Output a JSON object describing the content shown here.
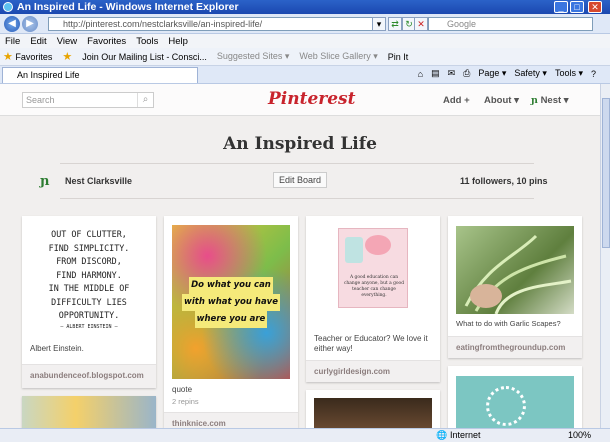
{
  "window": {
    "title": "An Inspired Life - Windows Internet Explorer"
  },
  "address": {
    "url": "http://pinterest.com/nestclarksville/an-inspired-life/",
    "search_placeholder": "Google"
  },
  "menu": [
    "File",
    "Edit",
    "View",
    "Favorites",
    "Tools",
    "Help"
  ],
  "favorites": {
    "label": "Favorites",
    "items": [
      "Join Our Mailing List - Consci...",
      "Suggested Sites ▾",
      "Web Slice Gallery ▾",
      "Pin It"
    ]
  },
  "tab": {
    "label": "An Inspired Life"
  },
  "toolbar": {
    "page": "Page ▾",
    "safety": "Safety ▾",
    "tools": "Tools ▾"
  },
  "pinterest": {
    "search_placeholder": "Search",
    "logo": "Pinterest",
    "nav": {
      "add": "Add +",
      "about": "About ▾",
      "user": "Nest ▾"
    },
    "board_title": "An Inspired Life",
    "owner": "Nest Clarksville",
    "edit_button": "Edit Board",
    "stats": "11 followers, 10 pins"
  },
  "pins": [
    {
      "quote_lines": [
        "OUT OF CLUTTER,",
        "FIND SIMPLICITY.",
        "FROM DISCORD,",
        "FIND HARMONY.",
        "IN THE MIDDLE OF",
        "DIFFICULTY LIES",
        "OPPORTUNITY."
      ],
      "quote_attr": "— ALBERT EINSTEIN —",
      "caption": "Albert Einstein.",
      "source": "anabundenceof.blogspot.com"
    },
    {
      "art_lines": [
        "Do what you can",
        "with what you have",
        "where you are"
      ],
      "caption": "quote",
      "repins": "2 repins",
      "source": "thinknice.com"
    },
    {
      "art_text": "A good education can change anyone, but a good teacher can change everything.",
      "caption": "Teacher or Educator? We love it either way!",
      "source": "curlygirldesign.com"
    },
    {
      "caption": "What to do with Garlic Scapes?",
      "source": "eatingfromthegroundup.com"
    }
  ],
  "status": {
    "zone": "Internet",
    "zoom": "100%"
  }
}
